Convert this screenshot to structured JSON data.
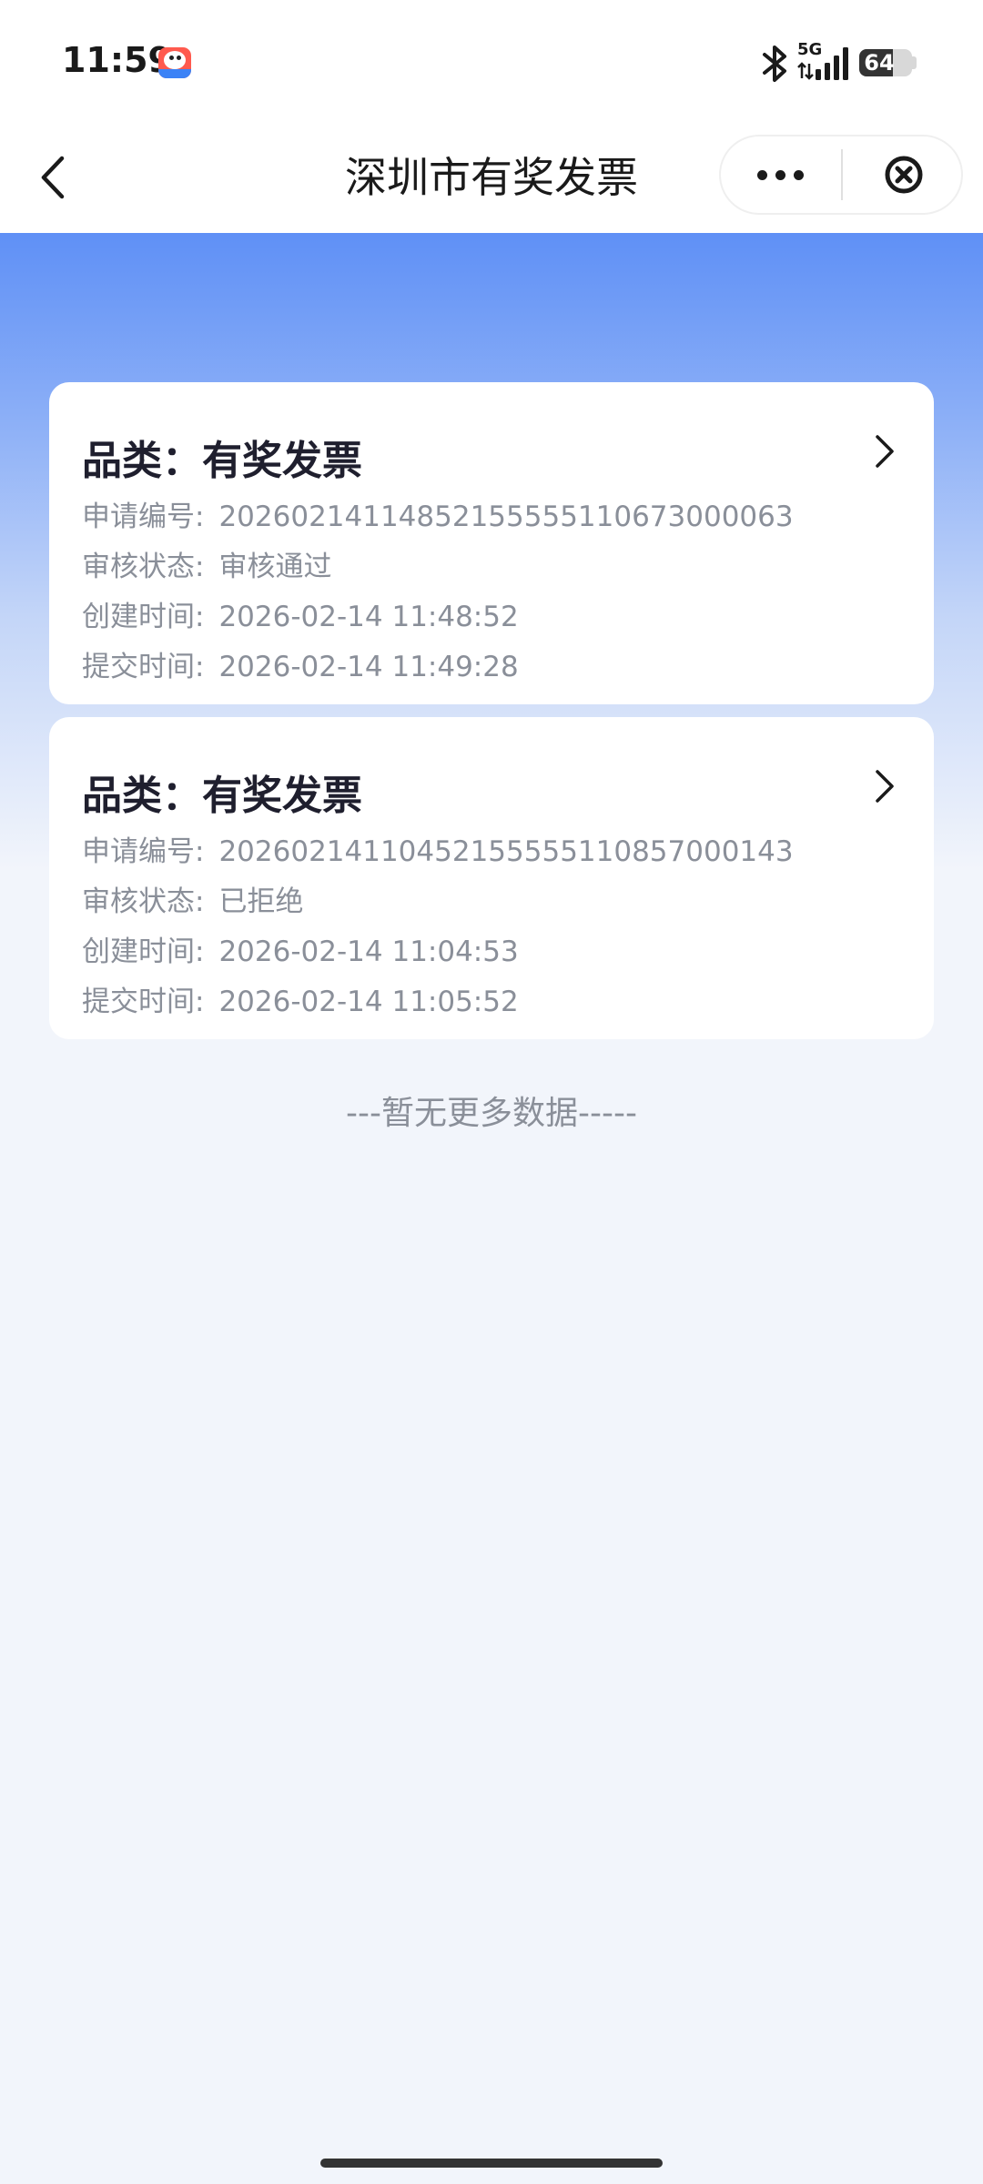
{
  "status_bar": {
    "time": "11:59",
    "network": "5G",
    "battery_level": 64,
    "battery_text": "64",
    "icons": [
      "app-badge-icon",
      "bluetooth-icon",
      "signal-icon",
      "battery-icon"
    ]
  },
  "nav": {
    "title": "深圳市有奖发票",
    "back_icon": "chevron-left-icon",
    "more_icon": "more-dots-icon",
    "close_icon": "close-circle-icon"
  },
  "records": [
    {
      "title": "品类：有奖发票",
      "rows": [
        {
          "label": "申请编号:",
          "value": "20260214114852155555110673000063"
        },
        {
          "label": "审核状态:",
          "value": "审核通过"
        },
        {
          "label": "创建时间:",
          "value": "2026-02-14 11:48:52"
        },
        {
          "label": "提交时间:",
          "value": "2026-02-14 11:49:28"
        }
      ]
    },
    {
      "title": "品类：有奖发票",
      "rows": [
        {
          "label": "申请编号:",
          "value": "20260214110452155555110857000143"
        },
        {
          "label": "审核状态:",
          "value": "已拒绝"
        },
        {
          "label": "创建时间:",
          "value": "2026-02-14 11:04:53"
        },
        {
          "label": "提交时间:",
          "value": "2026-02-14 11:05:52"
        }
      ]
    }
  ],
  "footer_text": "---暂无更多数据-----",
  "colors": {
    "gradient_top": "#5f90f6",
    "page_background": "#f2f5fb",
    "card_background": "#ffffff",
    "muted_text": "#8a8f99",
    "title_text": "#1f1f2e"
  }
}
